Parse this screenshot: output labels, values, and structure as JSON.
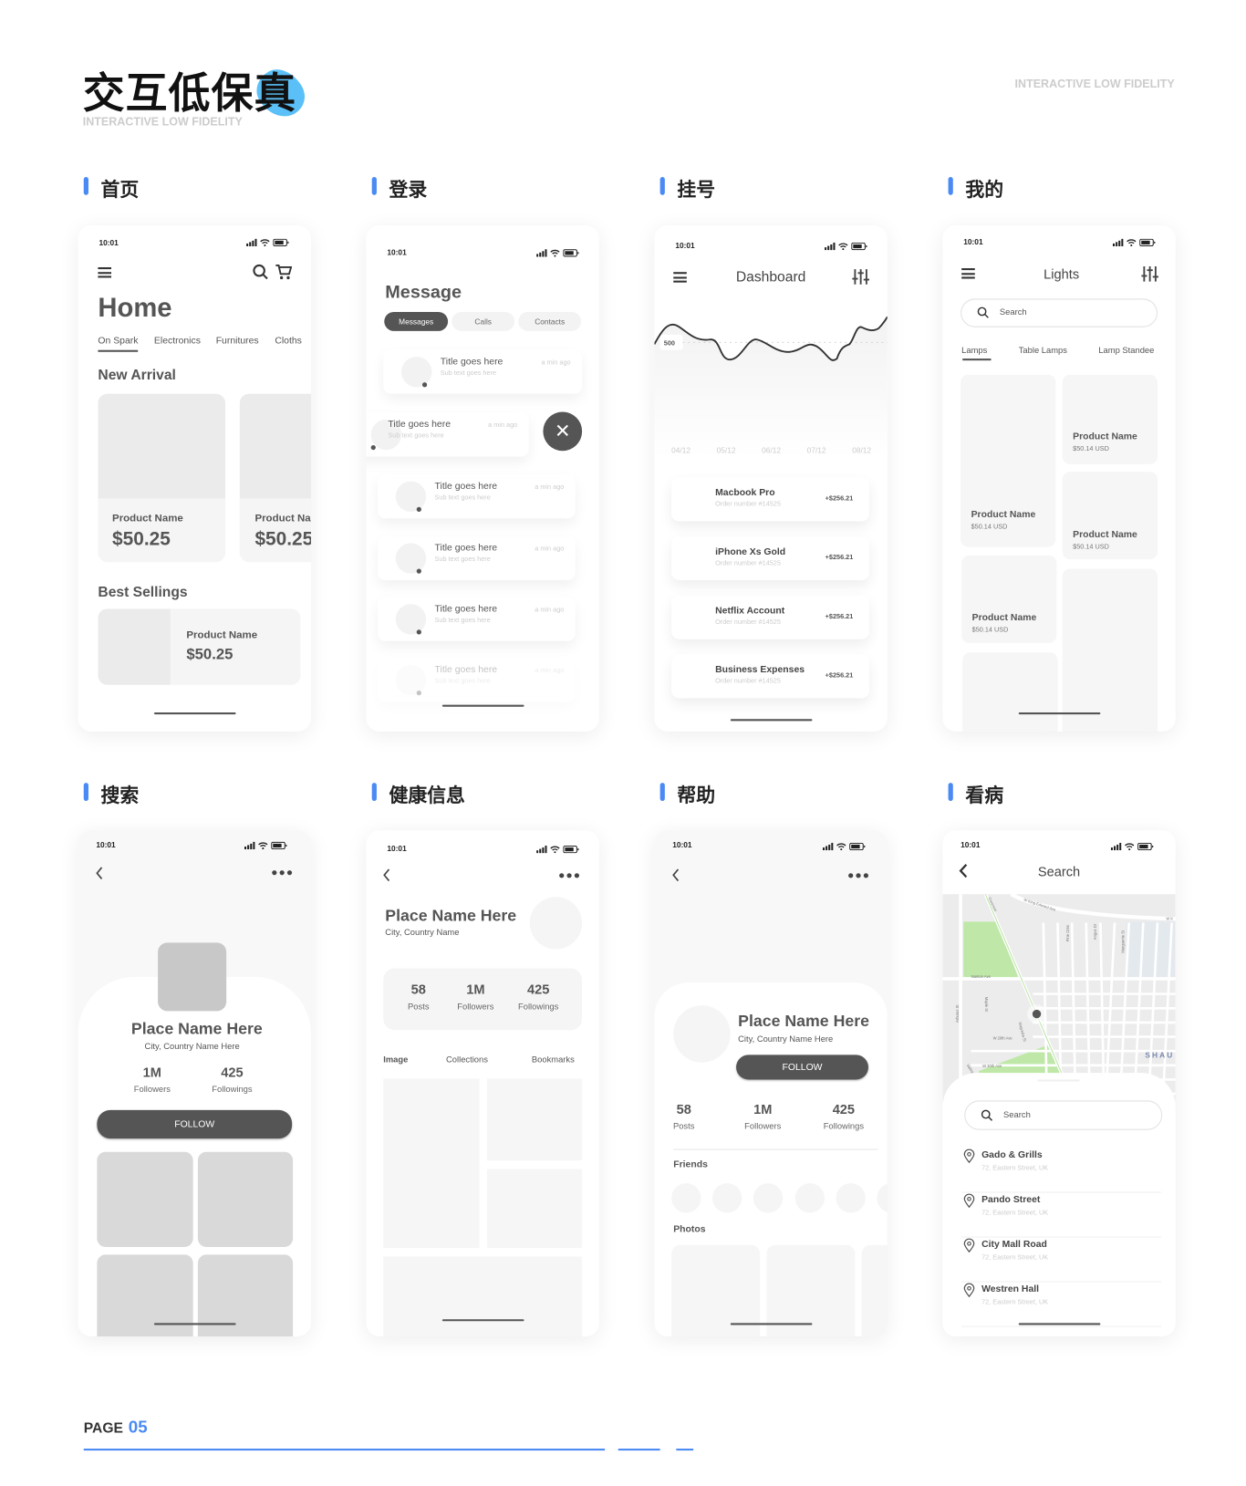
{
  "header": {
    "title": "交互低保真",
    "subtitle": "INTERACTIVE LOW FIDELITY",
    "right_label": "INTERACTIVE LOW FIDELITY",
    "accent": "#4a8af4",
    "blob_color": "#5bc0f8"
  },
  "sections": [
    "首页",
    "登录",
    "挂号",
    "我的",
    "搜索",
    "健康信息",
    "帮助",
    "看病"
  ],
  "status_time": "10:01",
  "home": {
    "title": "Home",
    "tabs": [
      "On Spark",
      "Electronics",
      "Furnitures",
      "Cloths"
    ],
    "new_arrival": "New Arrival",
    "products": [
      {
        "name": "Product Name",
        "price": "$50.25"
      },
      {
        "name": "Product Na",
        "price": "$50.25"
      }
    ],
    "best_sellings": "Best Sellings",
    "best": {
      "name": "Product Name",
      "price": "$50.25"
    }
  },
  "message": {
    "title": "Message",
    "tabs": [
      "Messages",
      "Calls",
      "Contacts"
    ],
    "items": [
      {
        "title": "Title goes here",
        "sub": "Sub text goes here",
        "time": "a min ago"
      },
      {
        "title": "Title goes here",
        "sub": "Sub text goes here",
        "time": "a min ago"
      },
      {
        "title": "Title goes here",
        "sub": "Sub text goes here",
        "time": "a min ago"
      },
      {
        "title": "Title goes here",
        "sub": "Sub text goes here",
        "time": "a min ago"
      },
      {
        "title": "Title goes here",
        "sub": "Sub text goes here",
        "time": "a min ago"
      },
      {
        "title": "Title goes here",
        "sub": "Sub text goes here",
        "time": "a min ago"
      }
    ]
  },
  "dashboard": {
    "title": "Dashboard",
    "chart": {
      "marker_label": "500",
      "x_labels": [
        "04/12",
        "05/12",
        "06/12",
        "07/12",
        "08/12"
      ]
    },
    "orders": [
      {
        "name": "Macbook Pro",
        "order": "Order number #14525",
        "amount": "+$256.21"
      },
      {
        "name": "iPhone Xs Gold",
        "order": "Order number #14525",
        "amount": "+$256.21"
      },
      {
        "name": "Netflix Account",
        "order": "Order number #14525",
        "amount": "+$256.21"
      },
      {
        "name": "Business Expenses",
        "order": "Order number #14525",
        "amount": "+$256.21"
      }
    ]
  },
  "lights": {
    "title": "Lights",
    "search_placeholder": "Search",
    "tabs": [
      "Lamps",
      "Table Lamps",
      "Lamp Standee"
    ],
    "products": [
      {
        "name": "Product Name",
        "price": "$50.14 USD"
      },
      {
        "name": "Product Name",
        "price": "$50.14 USD"
      },
      {
        "name": "Product Name",
        "price": "$50.14 USD"
      },
      {
        "name": "Product Name",
        "price": "$50.14 USD"
      }
    ]
  },
  "profile1": {
    "name": "Place Name Here",
    "location": "City, Country Name Here",
    "followers": "1M",
    "followers_label": "Followers",
    "followings": "425",
    "followings_label": "Followings",
    "follow": "FOLLOW"
  },
  "profile2": {
    "name": "Place Name Here",
    "location": "City, Country Name",
    "posts": "58",
    "posts_label": "Posts",
    "followers": "1M",
    "followers_label": "Followers",
    "followings": "425",
    "followings_label": "Followings",
    "tabs": [
      "Image",
      "Collections",
      "Bookmarks"
    ]
  },
  "profile3": {
    "name": "Place Name Here",
    "location": "City, Country Name Here",
    "follow": "FOLLOW",
    "posts": "58",
    "posts_label": "Posts",
    "followers": "1M",
    "followers_label": "Followers",
    "followings": "425",
    "followings_label": "Followings",
    "friends": "Friends",
    "photos": "Photos"
  },
  "map_search": {
    "title": "Search",
    "search_placeholder": "Search",
    "map_labels": [
      "W King Edward Ave",
      "W K",
      "Nanton Ave",
      "Arbutus St",
      "Maple St",
      "W 29th Ave",
      "W 30th Ave",
      "Valley Dr",
      "Magnolia St",
      "Pine Cres",
      "Angus Dr",
      "Marguerite St",
      "SHAU",
      "Crescent"
    ],
    "places": [
      {
        "name": "Gado & Grills",
        "address": "72, Eastern Street, UK"
      },
      {
        "name": "Pando Street",
        "address": "72, Eastern Street, UK"
      },
      {
        "name": "City Mall Road",
        "address": "72, Eastern Street, UK"
      },
      {
        "name": "Westren Hall",
        "address": "72, Eastern Street, UK"
      }
    ]
  },
  "footer": {
    "page_label": "PAGE",
    "page_number": "05"
  }
}
